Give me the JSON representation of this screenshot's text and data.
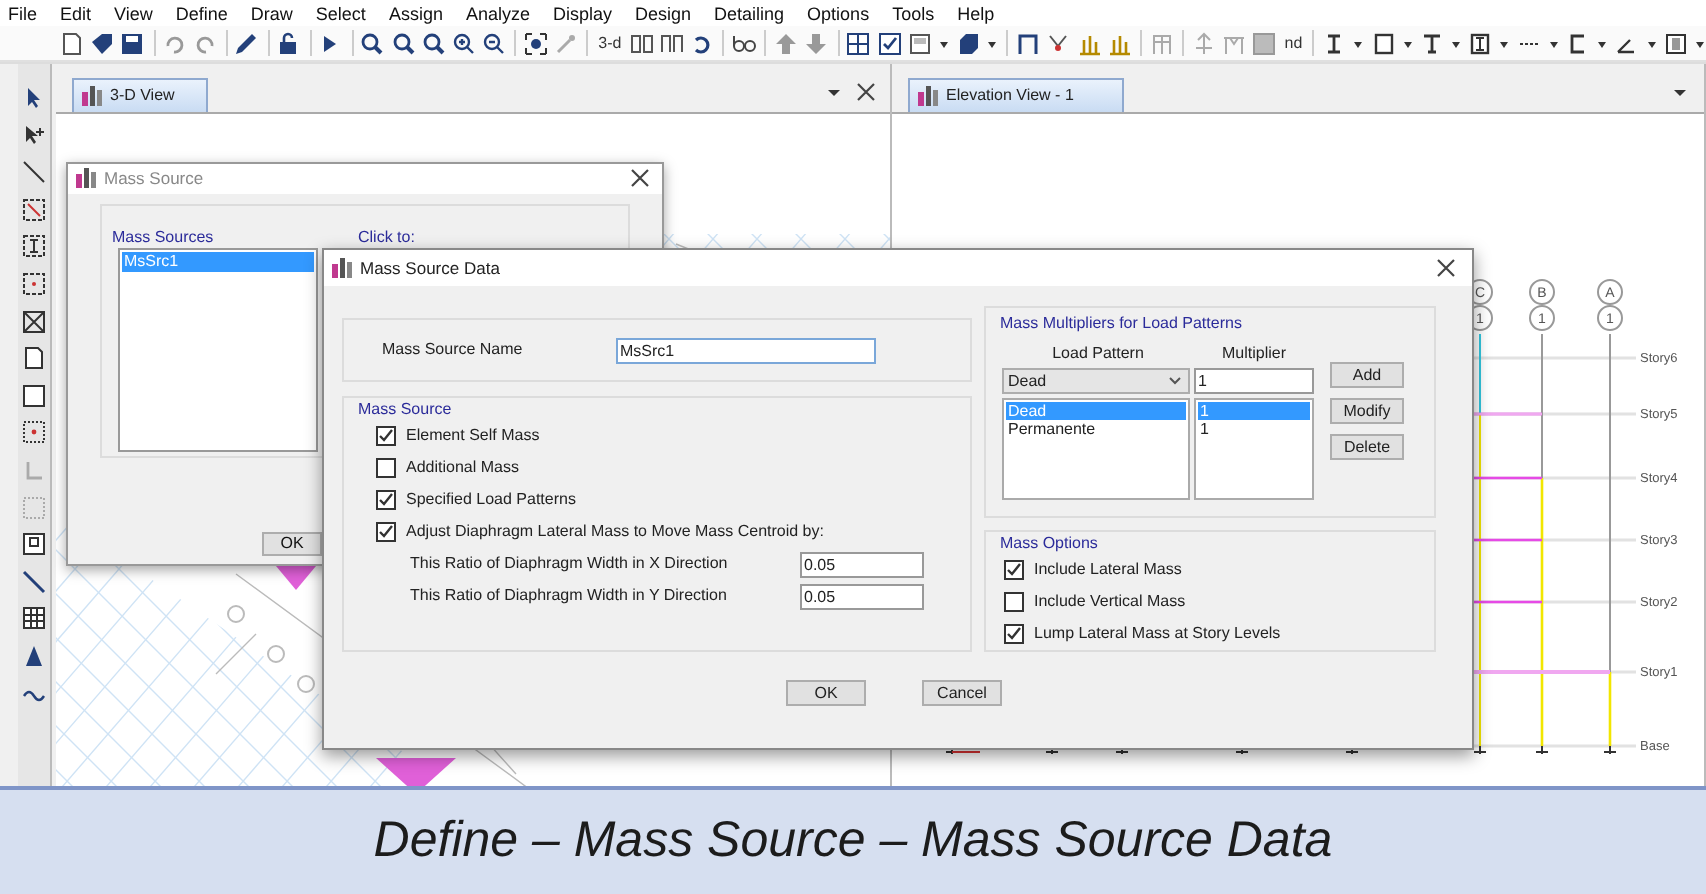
{
  "menu": [
    "File",
    "Edit",
    "View",
    "Define",
    "Draw",
    "Select",
    "Assign",
    "Analyze",
    "Display",
    "Design",
    "Detailing",
    "Options",
    "Tools",
    "Help"
  ],
  "toolbar_labels": [
    "3-d",
    "nd"
  ],
  "views": [
    {
      "tab": "3-D View",
      "kind": "model"
    },
    {
      "tab": "Elevation View - 1",
      "kind": "elevation"
    }
  ],
  "elevation": {
    "grid_lines": [
      {
        "letter": "C",
        "number": "1"
      },
      {
        "letter": "B",
        "number": "1"
      },
      {
        "letter": "A",
        "number": "1"
      }
    ],
    "stories": [
      "Story6",
      "Story5",
      "Story4",
      "Story3",
      "Story2",
      "Story1",
      "Base"
    ]
  },
  "mass_source_dialog": {
    "title": "Mass Source",
    "list_title": "Mass Sources",
    "items": [
      {
        "label": "MsSrc1",
        "selected": true
      }
    ],
    "click_to": "Click to:",
    "ok": "OK"
  },
  "data_dialog": {
    "title": "Mass Source Data",
    "name_label": "Mass Source Name",
    "name_value": "MsSrc1",
    "mass_source": {
      "title": "Mass Source",
      "options": [
        {
          "label": "Element Self Mass",
          "checked": true
        },
        {
          "label": "Additional Mass",
          "checked": false
        },
        {
          "label": "Specified Load Patterns",
          "checked": true
        },
        {
          "label": "Adjust Diaphragm Lateral Mass to Move Mass Centroid by:",
          "checked": true
        }
      ],
      "ratios": [
        {
          "label": "This Ratio of Diaphragm Width in X Direction",
          "value": "0.05"
        },
        {
          "label": "This Ratio of Diaphragm Width in Y Direction",
          "value": "0.05"
        }
      ]
    },
    "multipliers": {
      "title": "Mass Multipliers for Load Patterns",
      "pattern_header": "Load Pattern",
      "multiplier_header": "Multiplier",
      "pattern_choice": "Dead",
      "multiplier_value": "1",
      "rows": [
        {
          "pattern": "Dead",
          "multiplier": "1",
          "selected": true
        },
        {
          "pattern": "Permanente",
          "multiplier": "1",
          "selected": false
        }
      ],
      "buttons": [
        "Add",
        "Modify",
        "Delete"
      ]
    },
    "mass_options": {
      "title": "Mass Options",
      "options": [
        {
          "label": "Include Lateral Mass",
          "checked": true
        },
        {
          "label": "Include Vertical Mass",
          "checked": false
        },
        {
          "label": "Lump Lateral Mass at Story Levels",
          "checked": true
        }
      ]
    },
    "buttons": [
      "OK",
      "Cancel"
    ]
  },
  "caption": "Define – Mass Source – Mass Source Data"
}
